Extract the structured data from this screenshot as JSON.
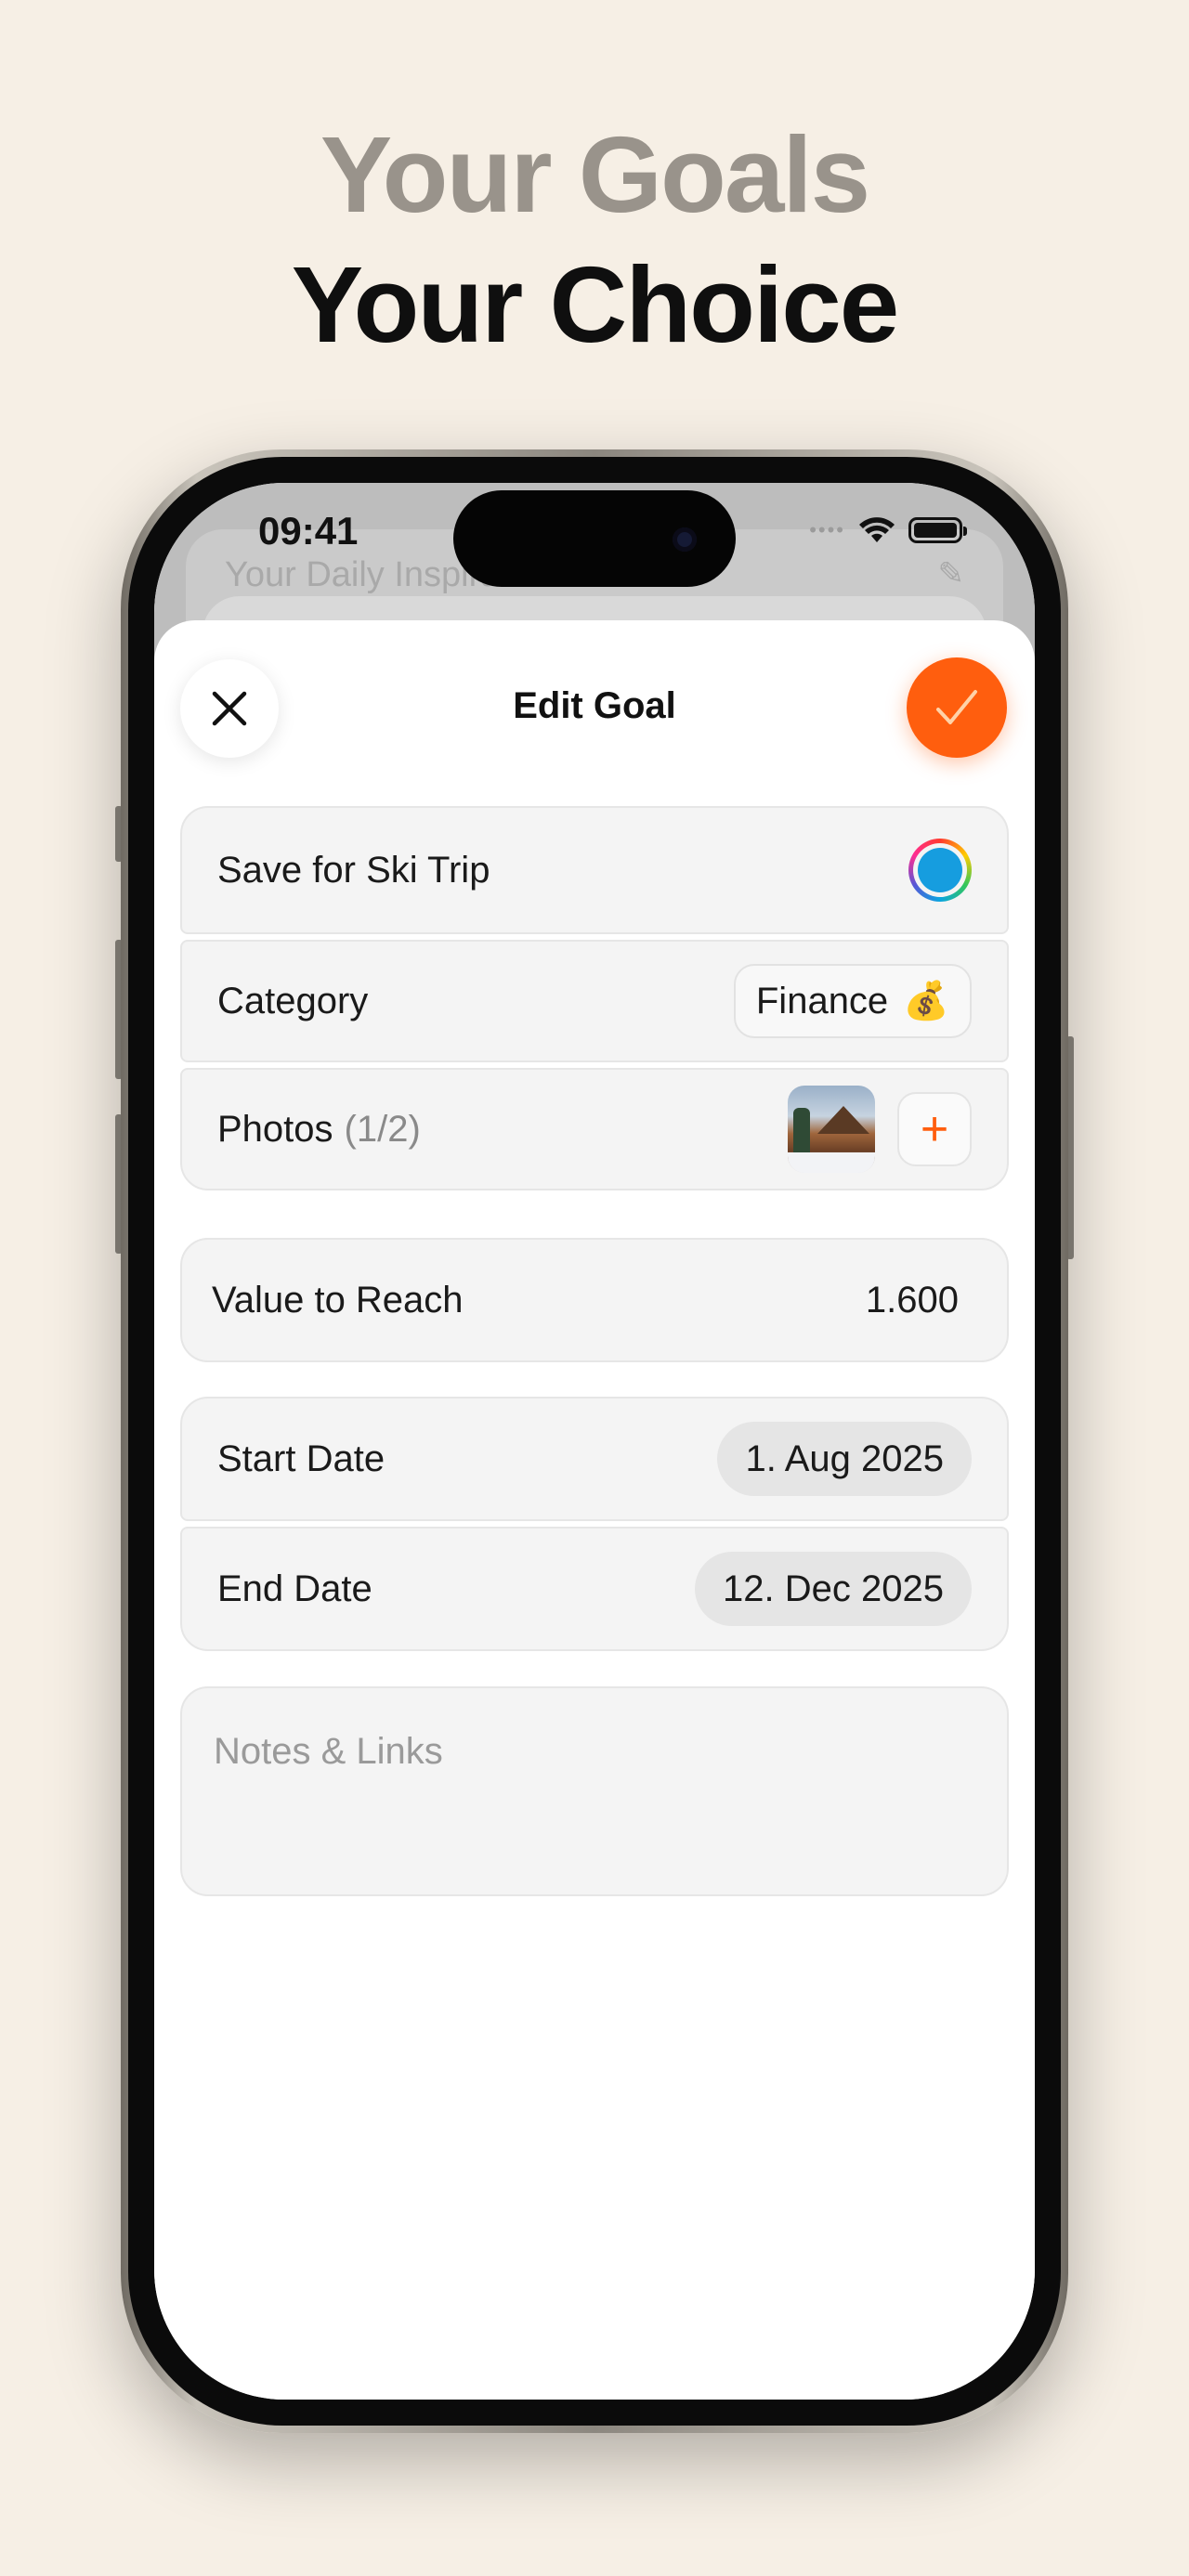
{
  "headline": {
    "line1": "Your Goals",
    "line2": "Your Choice"
  },
  "status_bar": {
    "time": "09:41",
    "signal": "••••"
  },
  "background_app": {
    "title": "Your Daily Inspiration",
    "edit_icon": "pencil-icon"
  },
  "sheet": {
    "title": "Edit Goal",
    "close_icon": "close-icon",
    "confirm_icon": "checkmark-icon",
    "accent_color": "#ff5e0e"
  },
  "goal": {
    "name": "Save for Ski Trip",
    "color_dot": "#169ddf",
    "category_label": "Category",
    "category_value": "Finance",
    "category_emoji": "💰",
    "photos_label": "Photos",
    "photos_count": "(1/2)",
    "add_photo": "+"
  },
  "target": {
    "label": "Value to Reach",
    "value": "1.600"
  },
  "dates": {
    "start_label": "Start Date",
    "start_value": "1. Aug 2025",
    "end_label": "End Date",
    "end_value": "12. Dec 2025"
  },
  "notes": {
    "placeholder": "Notes & Links"
  }
}
